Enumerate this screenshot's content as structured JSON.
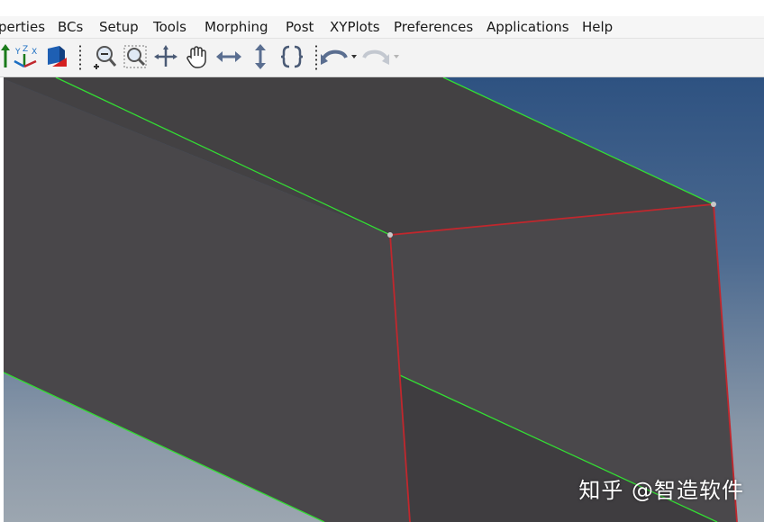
{
  "menubar": {
    "items": [
      "perties",
      "BCs",
      "Setup",
      "Tools",
      "Morphing",
      "Post",
      "XYPlots",
      "Preferences",
      "Applications",
      "Help"
    ]
  },
  "toolbar": {
    "icons": [
      "origin-axis-icon",
      "xyz-axis-icon",
      "view-cube-icon",
      "zoom-window-icon",
      "zoom-fit-icon",
      "rotate-crosshair-icon",
      "pan-hand-icon",
      "horizontal-arrows-icon",
      "vertical-arrows-icon",
      "spin-brackets-icon",
      "undo-view-icon",
      "redo-view-icon"
    ]
  },
  "viewport": {
    "background_top": "#2e5281",
    "background_bottom": "#9ca6b0",
    "face_color": "#464445",
    "edge_green": "#33dd33",
    "edge_red": "#c1272d"
  },
  "watermark": {
    "text": "知乎 @智造软件"
  }
}
